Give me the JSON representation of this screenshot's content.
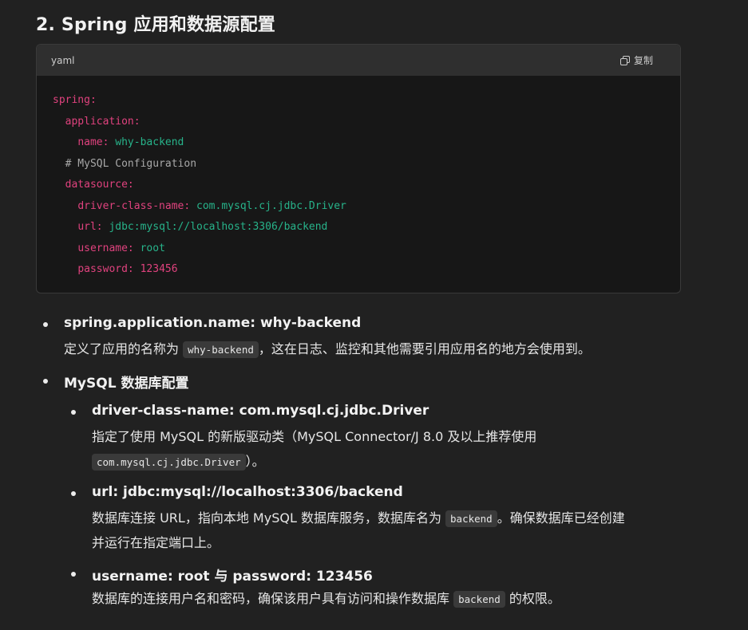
{
  "heading": "2. Spring 应用和数据源配置",
  "code": {
    "language": "yaml",
    "copy_label": "复制",
    "lines": [
      {
        "indent": "",
        "key": "spring:",
        "value": "",
        "type": "key"
      },
      {
        "indent": "  ",
        "key": "application:",
        "value": "",
        "type": "key"
      },
      {
        "indent": "    ",
        "key": "name:",
        "value": " why-backend",
        "type": "str"
      },
      {
        "indent": "  ",
        "key": "# MySQL Configuration",
        "value": "",
        "type": "comment"
      },
      {
        "indent": "  ",
        "key": "datasource:",
        "value": "",
        "type": "key"
      },
      {
        "indent": "    ",
        "key": "driver-class-name:",
        "value": " com.mysql.cj.jdbc.Driver",
        "type": "str"
      },
      {
        "indent": "    ",
        "key": "url:",
        "value": " jdbc:mysql://localhost:3306/backend",
        "type": "str"
      },
      {
        "indent": "    ",
        "key": "username:",
        "value": " root",
        "type": "str"
      },
      {
        "indent": "    ",
        "key": "password:",
        "value": " 123456",
        "type": "num"
      }
    ]
  },
  "list": {
    "item1": {
      "title": "spring.application.name: why-backend",
      "text_a": "定义了应用的名称为 ",
      "code": "why-backend",
      "text_b": "，这在日志、监控和其他需要引用应用名的地方会使用到。"
    },
    "item2": {
      "title": "MySQL 数据库配置"
    },
    "sub1": {
      "title": "driver-class-name: com.mysql.cj.jdbc.Driver",
      "text_a": "指定了使用 MySQL 的新版驱动类（MySQL Connector/J 8.0 及以上推荐使用",
      "code": "com.mysql.cj.jdbc.Driver",
      "text_b": "）。"
    },
    "sub2": {
      "title": "url: jdbc:mysql://localhost:3306/backend",
      "text_a": "数据库连接 URL，指向本地 MySQL 数据库服务，数据库名为 ",
      "code": "backend",
      "text_b": "。确保数据库已经创建",
      "text_c": "并运行在指定端口上。"
    },
    "sub3": {
      "title": "username: root 与 password: 123456",
      "text_a": "数据库的连接用户名和密码，确保该用户具有访问和操作数据库 ",
      "code": "backend",
      "text_b": " 的权限。"
    }
  }
}
